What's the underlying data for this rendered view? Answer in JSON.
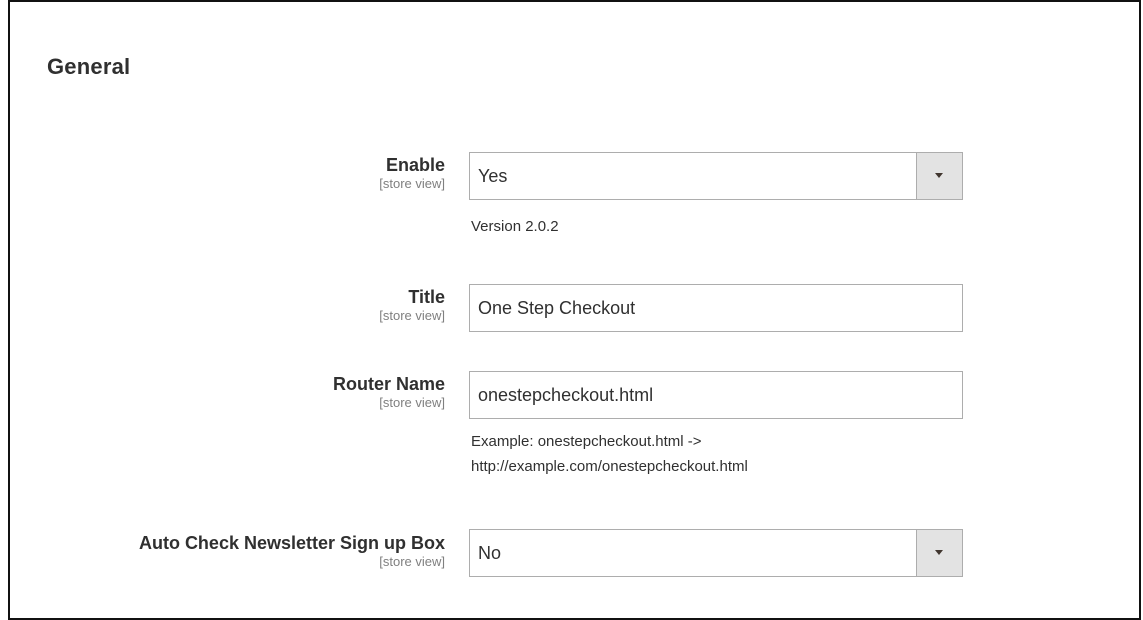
{
  "section": {
    "title": "General"
  },
  "fields": {
    "enable": {
      "label": "Enable",
      "scope": "[store view]",
      "value": "Yes",
      "note": "Version 2.0.2"
    },
    "title": {
      "label": "Title",
      "scope": "[store view]",
      "value": "One Step Checkout"
    },
    "router_name": {
      "label": "Router Name",
      "scope": "[store view]",
      "value": "onestepcheckout.html",
      "note_line1": "Example: onestepcheckout.html ->",
      "note_line2": "http://example.com/onestepcheckout.html"
    },
    "auto_newsletter": {
      "label": "Auto Check Newsletter Sign up Box",
      "scope": "[store view]",
      "value": "No"
    }
  },
  "icons": {
    "select_arrow": "chevron-down-icon"
  }
}
